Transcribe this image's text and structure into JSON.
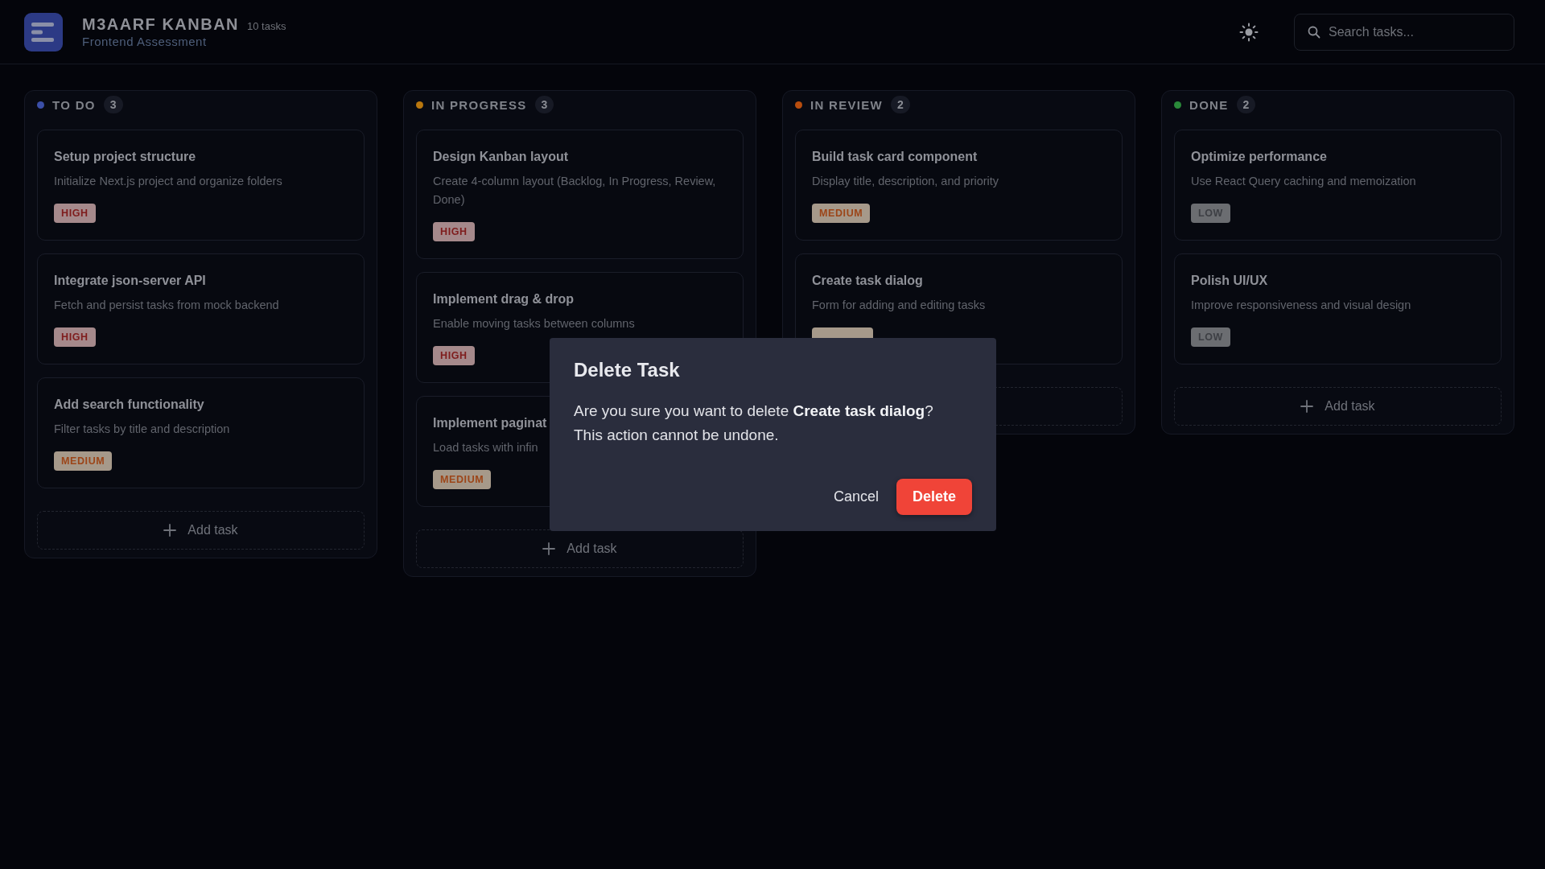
{
  "app": {
    "title": "M3AARF KANBAN",
    "task_count": "10 tasks",
    "subtitle": "Frontend Assessment"
  },
  "search": {
    "placeholder": "Search tasks..."
  },
  "columns": [
    {
      "title": "TO DO",
      "count": "3",
      "color": "#3b4fa8",
      "add_label": "Add task",
      "cards": [
        {
          "title": "Setup project structure",
          "description": "Initialize Next.js project and organize folders",
          "kind": "high",
          "badge": "HIGH"
        },
        {
          "title": "Integrate json-server API",
          "description": "Fetch and persist tasks from mock backend",
          "kind": "high",
          "badge": "HIGH"
        },
        {
          "title": "Add search functionality",
          "description": "Filter tasks by title and description",
          "kind": "medium",
          "badge": "MEDIUM"
        }
      ]
    },
    {
      "title": "IN PROGRESS",
      "count": "3",
      "color": "#b9770e",
      "add_label": "Add task",
      "cards": [
        {
          "title": "Design Kanban layout",
          "description": "Create 4-column layout (Backlog, In Progress, Review, Done)",
          "kind": "high",
          "badge": "HIGH"
        },
        {
          "title": "Implement drag & drop",
          "description": "Enable moving tasks between columns",
          "kind": "high",
          "badge": "HIGH"
        },
        {
          "title": "Implement paginat",
          "description": "Load tasks with infin",
          "kind": "medium",
          "badge": "MEDIUM"
        }
      ]
    },
    {
      "title": "IN REVIEW",
      "count": "2",
      "color": "#b84d0e",
      "cards": [
        {
          "title": "Build task card component",
          "description": "Display title, description, and priority",
          "kind": "medium",
          "badge": "MEDIUM"
        },
        {
          "title": "Create task dialog",
          "description": "Form for adding and editing tasks",
          "kind": "medium"
        }
      ]
    },
    {
      "title": "DONE",
      "count": "2",
      "color": "#2a8a3a",
      "add_label": "Add task",
      "cards": [
        {
          "title": "Optimize performance",
          "description": "Use React Query caching and memoization",
          "kind": "low",
          "badge": "LOW"
        },
        {
          "title": "Polish UI/UX",
          "description": "Improve responsiveness and visual design",
          "kind": "low",
          "badge": "LOW"
        }
      ]
    }
  ],
  "dialog": {
    "title": "Delete Task",
    "message": "Are you sure you want to delete **Create task dialog**?\nThis action cannot be undone.",
    "buttons": [
      {
        "label": "Cancel",
        "kind": "secondary"
      },
      {
        "label": "Delete",
        "kind": "danger"
      }
    ]
  }
}
